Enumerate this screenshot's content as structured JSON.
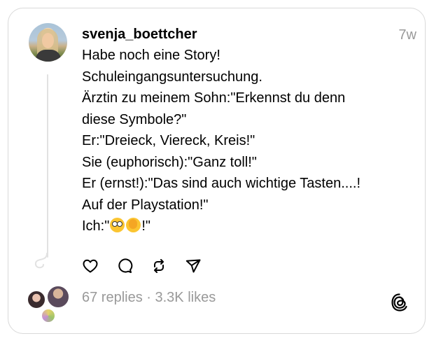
{
  "post": {
    "username": "svenja_boettcher",
    "time": "7w",
    "lines": [
      "Habe noch eine Story!",
      "Schuleingangsuntersuchung.",
      "Ärztin zu meinem Sohn:\"Erkennst du denn",
      "diese Symbole?\"",
      "Er:\"Dreieck, Viereck, Kreis!\"",
      "Sie (euphorisch):\"Ganz toll!\"",
      "Er (ernst!):\"Das sind auch wichtige Tasten....!",
      "Auf der Playstation!\""
    ],
    "last_line_prefix": "Ich:\"",
    "last_line_suffix": "!\"",
    "emojis": [
      "flushed-face",
      "face-with-hand-over-mouth"
    ]
  },
  "actions": {
    "icons": [
      "heart-icon",
      "comment-icon",
      "repost-icon",
      "share-icon"
    ]
  },
  "footer": {
    "stats": "67 replies · 3.3K likes",
    "logo": "threads-logo"
  }
}
